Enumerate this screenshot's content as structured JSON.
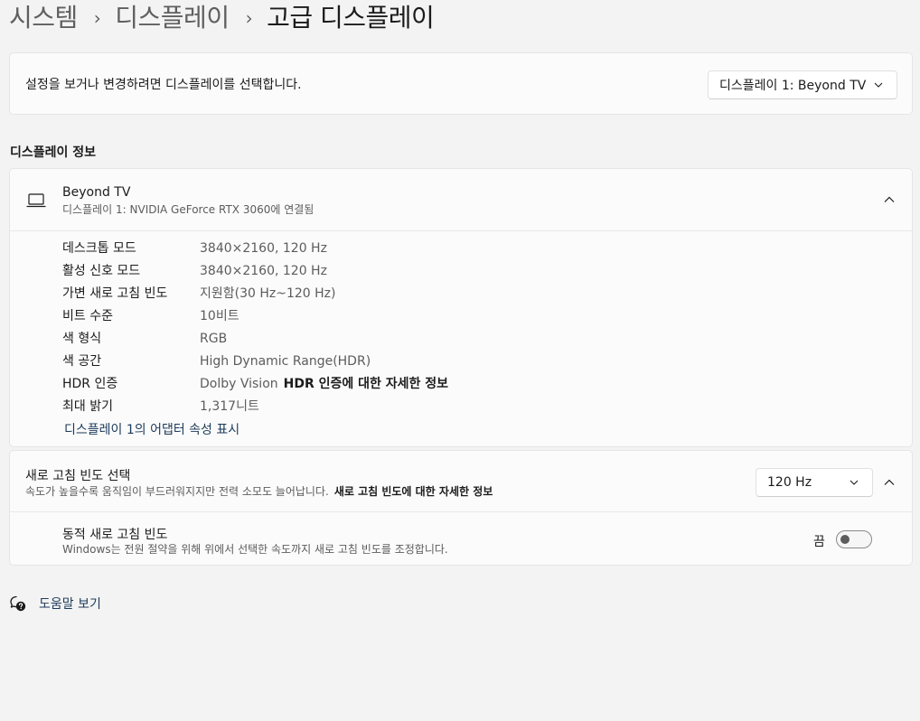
{
  "breadcrumb": {
    "items": [
      "시스템",
      "디스플레이"
    ],
    "current": "고급 디스플레이",
    "separator": "›"
  },
  "select_display": {
    "text": "설정을 보거나 변경하려면 디스플레이를 선택합니다.",
    "dropdown_value": "디스플레이 1: Beyond TV"
  },
  "display_info": {
    "section_title": "디스플레이 정보",
    "name": "Beyond TV",
    "subtitle": "디스플레이 1: NVIDIA GeForce RTX 3060에 연결됨",
    "rows": [
      {
        "label": "데스크톱 모드",
        "value": "3840×2160, 120 Hz"
      },
      {
        "label": "활성 신호 모드",
        "value": "3840×2160, 120 Hz"
      },
      {
        "label": "가변 새로 고침 빈도",
        "value": "지원함(30 Hz~120 Hz)"
      },
      {
        "label": "비트 수준",
        "value": "10비트"
      },
      {
        "label": "색 형식",
        "value": "RGB"
      },
      {
        "label": "색 공간",
        "value": "High Dynamic Range(HDR)"
      },
      {
        "label": "HDR 인증",
        "value": "Dolby Vision",
        "link": "HDR 인증에 대한 자세한 정보"
      },
      {
        "label": "최대 밝기",
        "value": "1,317니트"
      }
    ],
    "adapter_link": "디스플레이 1의 어댑터 속성 표시"
  },
  "refresh": {
    "title": "새로 고침 빈도 선택",
    "subtitle": "속도가 높을수록 움직임이 부드러워지지만 전력 소모도 늘어납니다.",
    "link": "새로 고침 빈도에 대한 자세한 정보",
    "dropdown_value": "120 Hz",
    "dynamic_title": "동적 새로 고침 빈도",
    "dynamic_subtitle": "Windows는 전원 절약을 위해 위에서 선택한 속도까지 새로 고침 빈도를 조정합니다.",
    "toggle_label": "끔"
  },
  "help": {
    "label": "도움말 보기"
  },
  "colors": {
    "background": "#f3f3f3",
    "card": "#fbfbfb",
    "link": "#1c3a5a"
  }
}
